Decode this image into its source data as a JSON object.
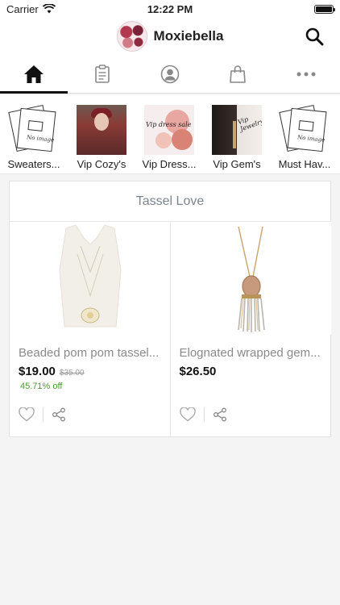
{
  "status_bar": {
    "carrier": "Carrier",
    "time": "12:22 PM"
  },
  "header": {
    "brand_name": "Moxiebella"
  },
  "tabs": [
    {
      "name": "home",
      "icon": "home-icon",
      "active": true
    },
    {
      "name": "orders",
      "icon": "clipboard-icon",
      "active": false
    },
    {
      "name": "account",
      "icon": "user-icon",
      "active": false
    },
    {
      "name": "bag",
      "icon": "shopping-bag-icon",
      "active": false
    },
    {
      "name": "more",
      "icon": "more-icon",
      "active": false
    }
  ],
  "categories": [
    {
      "label": "Sweaters..."
    },
    {
      "label": "Vip Cozy's"
    },
    {
      "label": "Vip Dress..."
    },
    {
      "label": "Vip Gem's"
    },
    {
      "label": "Must Hav..."
    }
  ],
  "category_images": {
    "no_image_text": "No image",
    "dress_script": "Vip dress sale",
    "gem_script": "Vip Jewelry"
  },
  "section": {
    "title": "Tassel Love"
  },
  "products": [
    {
      "name": "Beaded pom pom tassel...",
      "price": "$19.00",
      "old_price": "$35.00",
      "discount": "45.71% off"
    },
    {
      "name": "Elognated wrapped gem...",
      "price": "$26.50"
    }
  ],
  "colors": {
    "accent": "#111111",
    "discount_green": "#4a9f2f",
    "muted_title": "#7c8590"
  }
}
